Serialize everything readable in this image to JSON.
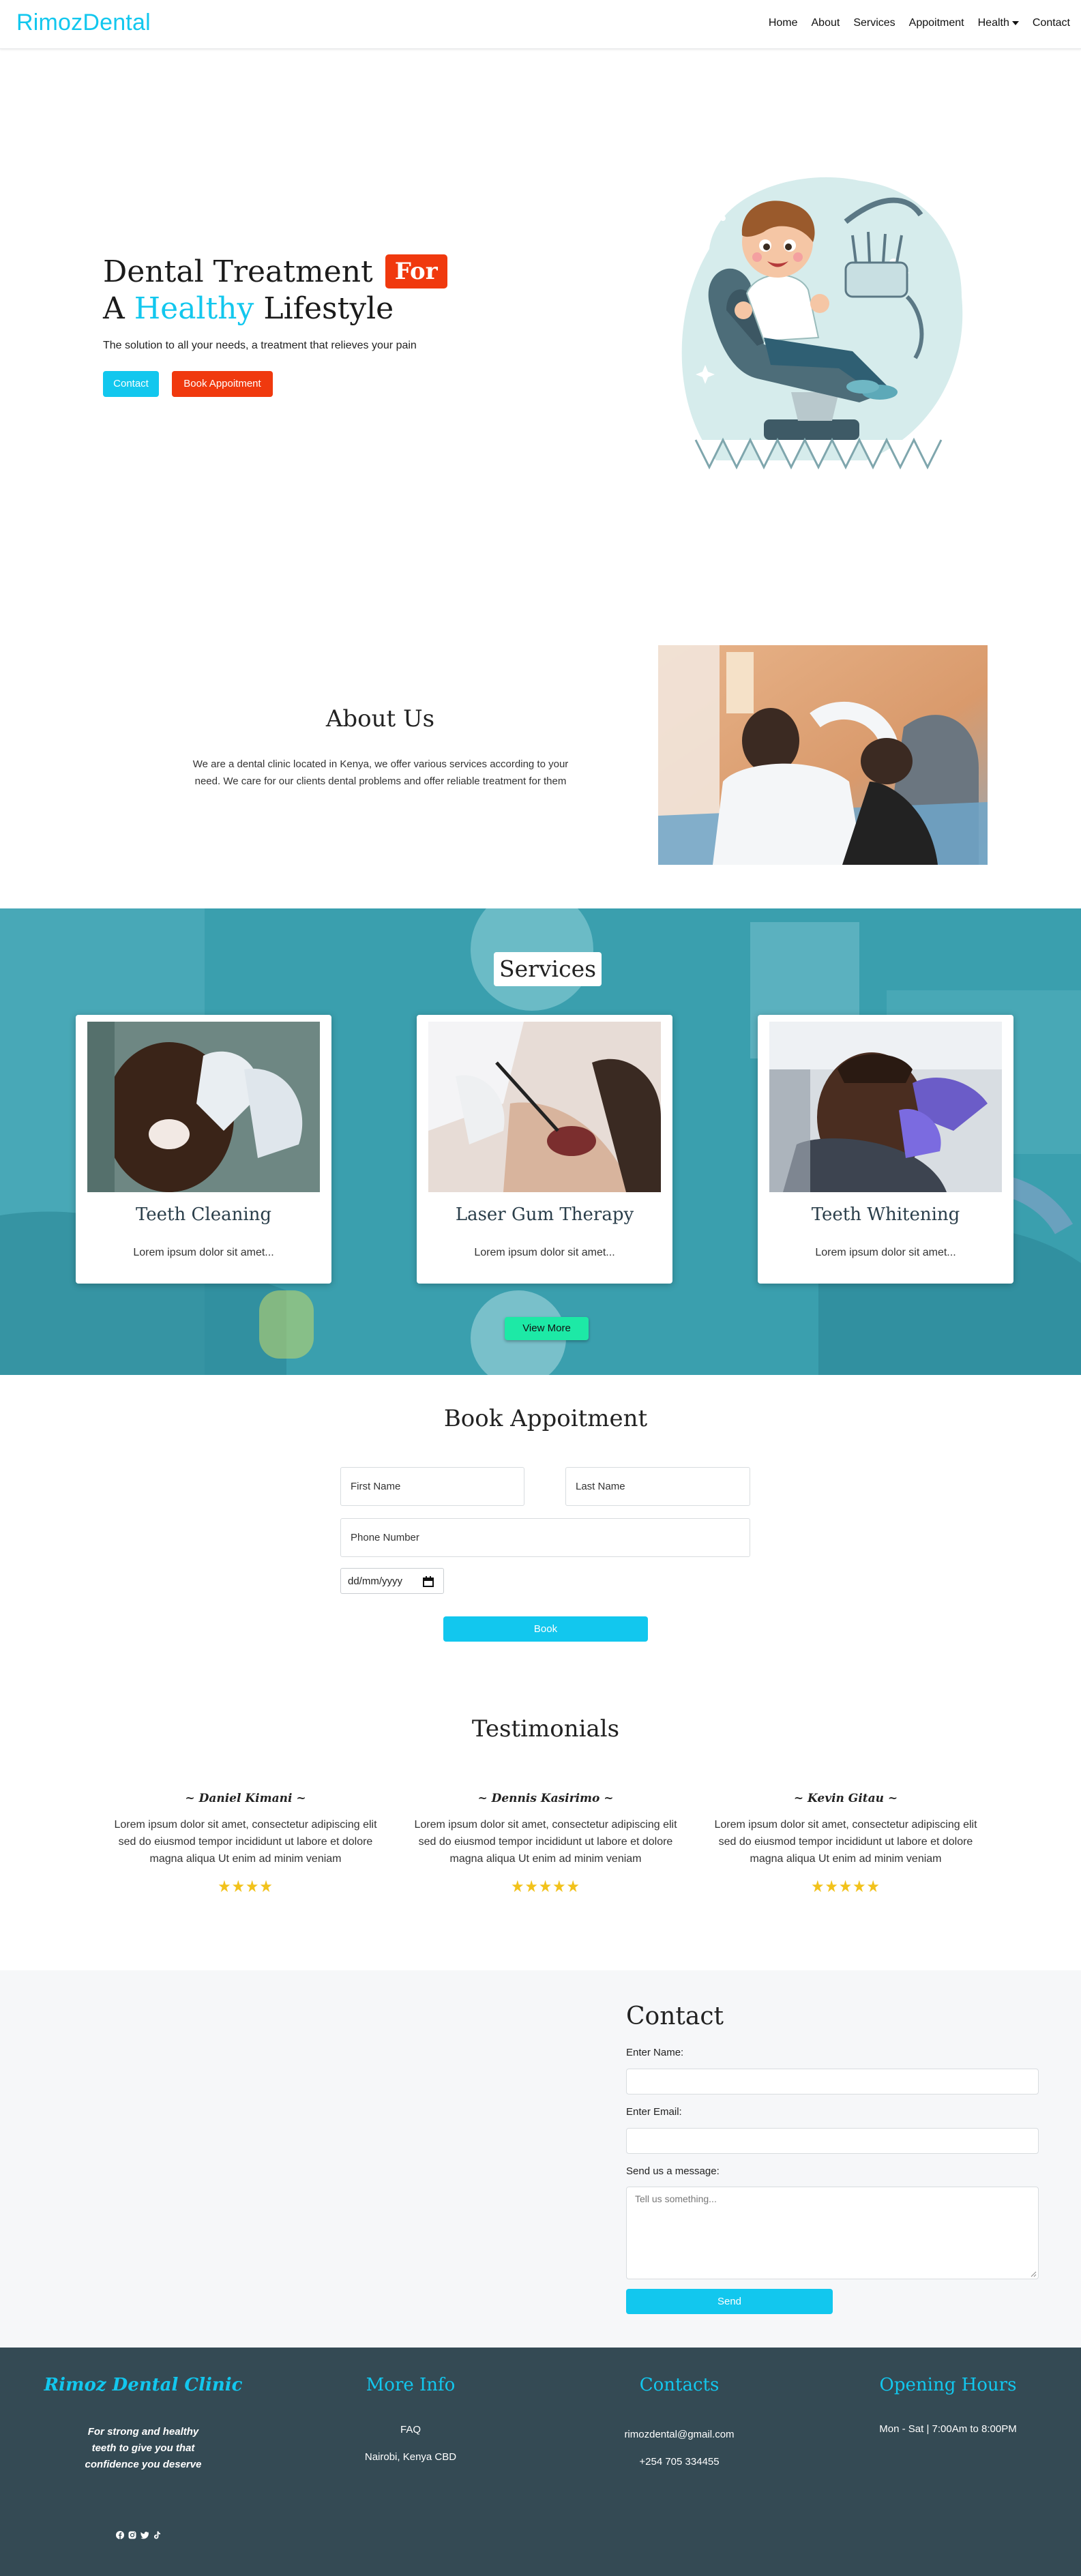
{
  "nav": {
    "brand": "RimozDental",
    "items": [
      "Home",
      "About",
      "Services",
      "Appoitment",
      "Health",
      "Contact"
    ]
  },
  "hero": {
    "title_line1": "Dental Treatment",
    "badge": "For",
    "title_line2_a": "A",
    "title_line2_highlight": "Healthy",
    "title_line2_b": "Lifestyle",
    "subtitle": "The solution to all your needs, a treatment that relieves your pain",
    "contact_button": "Contact",
    "book_button": "Book Appoitment"
  },
  "about": {
    "title": "About Us",
    "text": "We are a dental clinic located in Kenya, we offer various services according to your need. We care for our clients dental problems and offer reliable treatment for them"
  },
  "services": {
    "title": "Services",
    "cards": [
      {
        "title": "Teeth Cleaning",
        "desc": "Lorem ipsum dolor sit amet..."
      },
      {
        "title": "Laser Gum Therapy",
        "desc": "Lorem ipsum dolor sit amet..."
      },
      {
        "title": "Teeth Whitening",
        "desc": "Lorem ipsum dolor sit amet..."
      }
    ],
    "view_more": "View More"
  },
  "booking": {
    "title": "Book Appoitment",
    "first_name": "First Name",
    "last_name": "Last Name",
    "phone": "Phone Number",
    "date": "dd/mm/yyyy",
    "submit": "Book"
  },
  "testimonials": {
    "title": "Testimonials",
    "items": [
      {
        "name": "~ Daniel Kimani ~",
        "text": "Lorem ipsum dolor sit amet, consectetur adipiscing elit sed do eiusmod tempor incididunt ut labore et dolore magna aliqua Ut enim ad minim veniam",
        "stars": "★★★★",
        "rating": 4
      },
      {
        "name": "~ Dennis Kasirimo ~",
        "text": "Lorem ipsum dolor sit amet, consectetur adipiscing elit sed do eiusmod tempor incididunt ut labore et dolore magna aliqua Ut enim ad minim veniam",
        "stars": "★★★★★",
        "rating": 5
      },
      {
        "name": "~ Kevin Gitau ~",
        "text": "Lorem ipsum dolor sit amet, consectetur adipiscing elit sed do eiusmod tempor incididunt ut labore et dolore magna aliqua Ut enim ad minim veniam",
        "stars": "★★★★★",
        "rating": 5
      }
    ]
  },
  "contact": {
    "title": "Contact",
    "name_label": "Enter Name:",
    "email_label": "Enter Email:",
    "message_label": "Send us a message:",
    "message_placeholder": "Tell us something...",
    "send": "Send"
  },
  "footer": {
    "clinic_name": "Rimoz Dental Clinic",
    "tagline": "For strong and healthy teeth to give you that confidence you deserve",
    "more_info_title": "More Info",
    "faq": "FAQ",
    "address": "Nairobi, Kenya CBD",
    "contacts_title": "Contacts",
    "email": "rimozdental@gmail.com",
    "phone": "+254 705 334455",
    "hours_title": "Opening Hours",
    "hours": "Mon - Sat | 7:00Am to 8:00PM",
    "social_icons": [
      "facebook-icon",
      "instagram-icon",
      "twitter-icon",
      "tiktok-icon"
    ]
  },
  "colors": {
    "brand_cyan": "#12c7ee",
    "accent_red": "#f0390e",
    "view_more_green": "#1de9a6",
    "footer_bg": "#344a54",
    "services_overlay": "#2f9aa9"
  }
}
